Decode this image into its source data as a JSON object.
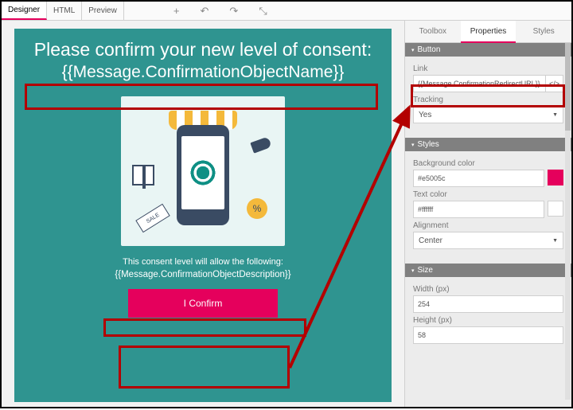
{
  "topbar": {
    "tabs": [
      "Designer",
      "HTML",
      "Preview"
    ],
    "active_tab": 0,
    "icons": {
      "add": "+",
      "undo": "↶",
      "redo": "↷",
      "snap": "⤡"
    }
  },
  "canvas": {
    "headline": "Please confirm your new level of consent:",
    "token_name": "{{Message.ConfirmationObjectName}}",
    "subtext": "This consent level will allow the following:",
    "token_desc": "{{Message.ConfirmationObjectDescription}}",
    "button_label": "I Confirm",
    "illustration": {
      "tag_label": "SALE",
      "coin_label": "%"
    }
  },
  "panel": {
    "tabs": [
      "Toolbox",
      "Properties",
      "Styles"
    ],
    "active_tab": 1,
    "sections": {
      "button": {
        "title": "Button",
        "link_label": "Link",
        "link_value": "{{Message.ConfirmationRedirectURL}}",
        "code_btn": "</>",
        "tracking_label": "Tracking",
        "tracking_value": "Yes"
      },
      "styles": {
        "title": "Styles",
        "bg_label": "Background color",
        "bg_value": "#e5005c",
        "text_label": "Text color",
        "text_value": "#ffffff",
        "align_label": "Alignment",
        "align_value": "Center"
      },
      "size": {
        "title": "Size",
        "width_label": "Width (px)",
        "width_value": "254",
        "height_label": "Height (px)",
        "height_value": "58"
      }
    }
  }
}
